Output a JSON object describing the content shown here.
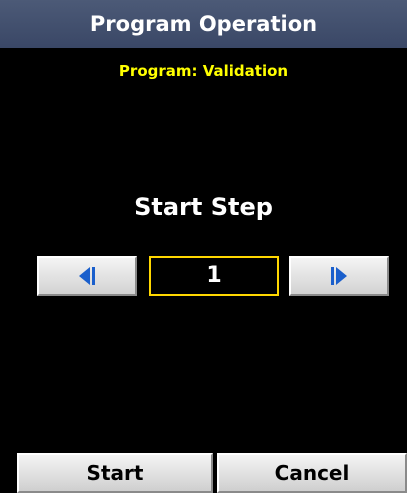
{
  "title": "Program Operation",
  "program_label": "Program: Validation",
  "step_heading": "Start Step",
  "step_value": "1",
  "icons": {
    "prev": "step-back-icon",
    "next": "step-forward-icon"
  },
  "buttons": {
    "start": "Start",
    "cancel": "Cancel"
  },
  "colors": {
    "title_bar": "#3f4c6b",
    "program_text": "#ffff00",
    "step_box_border": "#ffd700",
    "icon": "#1a5fcc",
    "background": "#000000"
  }
}
